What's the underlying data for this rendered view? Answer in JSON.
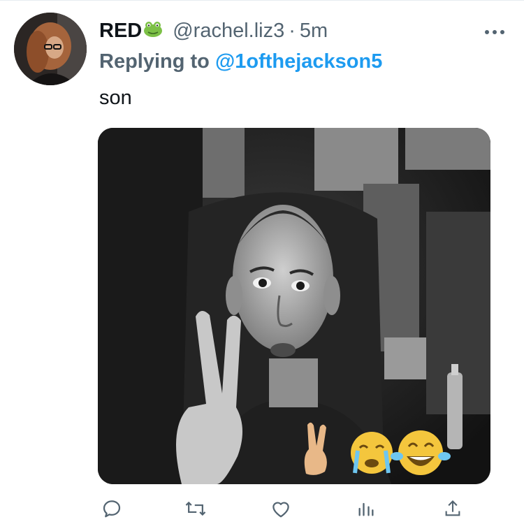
{
  "tweet": {
    "display_name": "RED",
    "name_emoji": "frog-emoji",
    "handle": "@rachel.liz3",
    "separator": "·",
    "time": "5m",
    "replying_prefix": "Replying to",
    "replying_to": "@1ofthejackson5",
    "text": "son"
  },
  "media": {
    "overlay_emojis": [
      "victory-hand-emoji",
      "crying-face-emoji",
      "tears-of-joy-emoji"
    ]
  },
  "actions": [
    "reply-icon",
    "retweet-icon",
    "like-icon",
    "analytics-icon",
    "share-icon"
  ],
  "colors": {
    "link": "#1d9bf0",
    "secondary": "#536471",
    "text": "#0f1419"
  }
}
